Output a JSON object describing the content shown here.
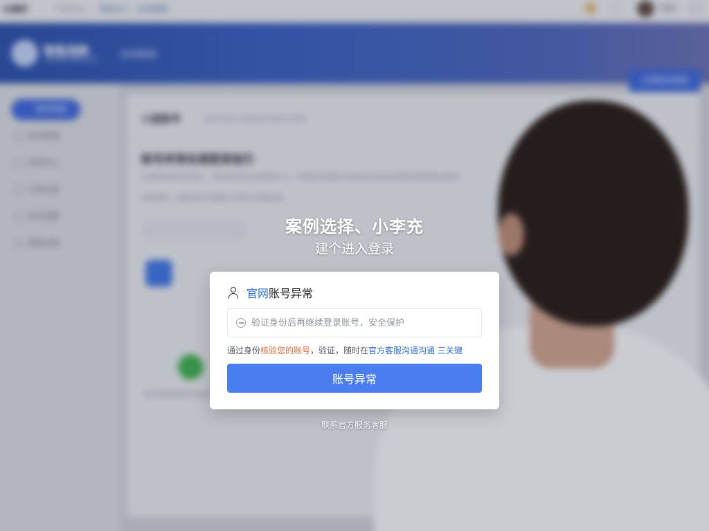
{
  "background": {
    "top_bar": {
      "brand": "AI案例",
      "crumbs": [
        "产品中心",
        "帮助中心 · 在线客服"
      ],
      "username": "User"
    },
    "banner": {
      "site_name": "智能选购",
      "site_sub": "ONLINE SERVICE",
      "section": "在线登录",
      "cta_label": "立即联系客服"
    },
    "sidebar": {
      "active": "首页导航",
      "items": [
        "账号管理",
        "消息中心",
        "订单记录",
        "安全设置",
        "帮助反馈"
      ]
    },
    "main": {
      "tab_title": "小蓝账号",
      "tab_hint": "账号信息与登录安全提示说明",
      "heading": "账号异常处理登录指引",
      "paragraph_1": "为保障您的账号安全，系统检测到异常登录行为，请按照页面提示完成身份验证后再继续使用相关服务。",
      "paragraph_2": "如有疑问，请联系官方客服人员进行沟通处理。",
      "foot_note": "验证完成后即可恢复正常使用"
    }
  },
  "overlay": {
    "hero_title": "案例选择、小李充",
    "hero_sub": "建个进入登录"
  },
  "dialog": {
    "title_highlight": "官网",
    "title_rest": "账号异常",
    "input_placeholder": "验证身份后再继续登录账号，安全保护",
    "note_prefix": "通过身份",
    "note_warn": "核验您的账号",
    "note_mid": "，验证，随时在",
    "note_link": "官方客服沟通沟通",
    "note_suffix": " 三关键",
    "button_label": "账号异常"
  },
  "footer_link": "联系官方服务客服",
  "colors": {
    "primary_button": "#4a7ef0",
    "link_blue": "#2f6fd6",
    "warning_orange": "#e46b3a",
    "banner_blue": "#2c4fa8"
  },
  "icons": {
    "dialog_title": "user-icon",
    "input_prefix": "shield-icon"
  }
}
